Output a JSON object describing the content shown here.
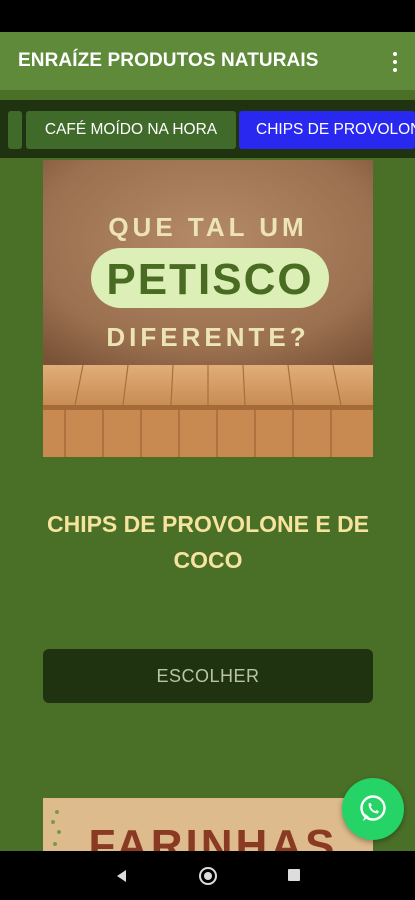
{
  "app_bar": {
    "title": "ENRAÍZE PRODUTOS NATURAIS",
    "menu_icon": "more-vert-icon"
  },
  "tabs": [
    {
      "label": ""
    },
    {
      "label": "CAFÉ MOÍDO NA HORA"
    },
    {
      "label": "CHIPS DE PROVOLONE E DE COCO",
      "selected": true
    }
  ],
  "product": {
    "image_text": {
      "line1": "QUE TAL UM",
      "line2": "PETISCO",
      "line3": "DIFERENTE?"
    },
    "title": "CHIPS DE PROVOLONE E DE COCO",
    "button_label": "ESCOLHER"
  },
  "next_product": {
    "image_text": "FARINHAS"
  },
  "fab": {
    "icon": "whatsapp-icon",
    "color": "#25d366"
  },
  "colors": {
    "background": "#4a7028",
    "app_bar": "#5e8a3a",
    "tab_strip": "#1f3311",
    "tab_selected": "#2828f0",
    "title_text": "#f6e39e"
  }
}
